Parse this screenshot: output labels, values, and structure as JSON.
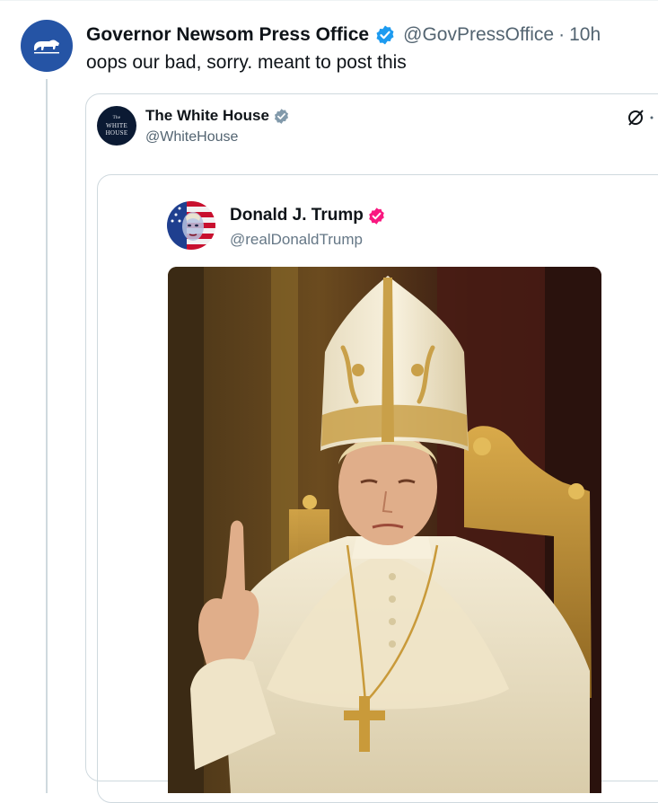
{
  "tweet": {
    "author_name": "Governor Newsom Press Office",
    "handle": "@GovPressOffice",
    "separator": "·",
    "time": "10h",
    "text": "oops our bad, sorry. meant to post this",
    "avatar_icon": "bear-icon",
    "verified_color": "#1d9bf0"
  },
  "quoted": {
    "author_name": "The White House",
    "handle": "@WhiteHouse",
    "avatar_icon": "white-house-logo",
    "verified_color": "#829aab",
    "more_icon": "grok-icon"
  },
  "nested_quote": {
    "author_name": "Donald J. Trump",
    "handle": "@realDonaldTrump",
    "avatar_icon": "flag-portrait-avatar",
    "verified_color": "#f91880"
  },
  "colors": {
    "accent": "#1d9bf0",
    "text_primary": "#0f1419",
    "text_secondary": "#536471",
    "border": "#cfd9de"
  }
}
